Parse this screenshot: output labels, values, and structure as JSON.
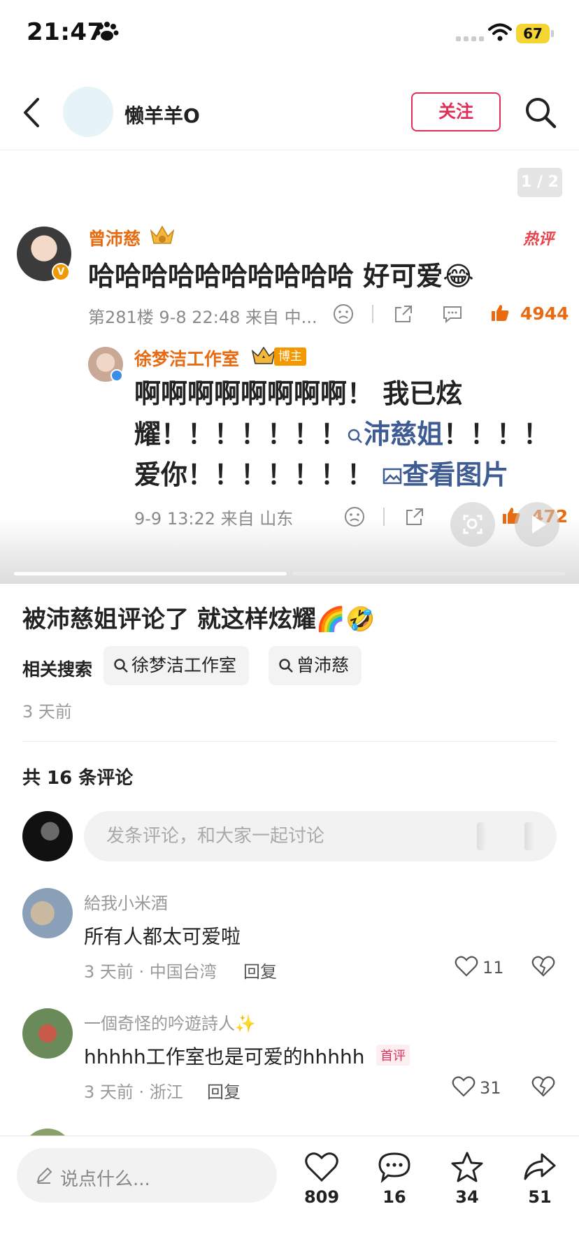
{
  "status_bar": {
    "time": "21:47",
    "battery": "67"
  },
  "header": {
    "username": "懒羊羊O",
    "follow_label": "关注"
  },
  "post_image": {
    "page_indicator": "1 / 2",
    "hot_label": "热评",
    "comment_main": {
      "author": "曾沛慈",
      "text": "哈哈哈哈哈哈哈哈哈哈 好可爱😂",
      "meta": "第281楼 9-8 22:48 来自 中...",
      "likes": "4944"
    },
    "comment_reply": {
      "author": "徐梦洁工作室",
      "badge": "博主",
      "text_part1": "啊啊啊啊啊啊啊啊！ 我已炫耀！！！！！！！",
      "mention": "沛慈姐",
      "text_part2": "！！！！爱你！！！！！！！",
      "image_link": "查看图片",
      "meta": "9-9 13:22 来自 山东",
      "likes": "472"
    }
  },
  "note": {
    "title": "被沛慈姐评论了 就这样炫耀🌈🤣",
    "related_label": "相关搜索",
    "tags": [
      "徐梦洁工作室",
      "曾沛慈"
    ],
    "time": "3 天前"
  },
  "comments": {
    "count_label": "共 16 条评论",
    "input_placeholder": "发条评论，和大家一起讨论",
    "reply_label": "回复",
    "first_tag": "首评",
    "items": [
      {
        "name": "給我小米酒",
        "text": "所有人都太可爱啦",
        "meta": "3 天前 · 中国台湾",
        "likes": "11"
      },
      {
        "name": "一個奇怪的吟遊詩人✨",
        "text": "hhhhh工作室也是可爱的hhhhh",
        "meta": "3 天前 · 浙江",
        "likes": "31"
      },
      {
        "name": "…"
      }
    ]
  },
  "bottom_bar": {
    "say_placeholder": "说点什么...",
    "likes": "809",
    "comments": "16",
    "stars": "34",
    "shares": "51"
  },
  "colors": {
    "accent": "#e0305a",
    "orange": "#e86b12",
    "link": "#3e5b93"
  }
}
